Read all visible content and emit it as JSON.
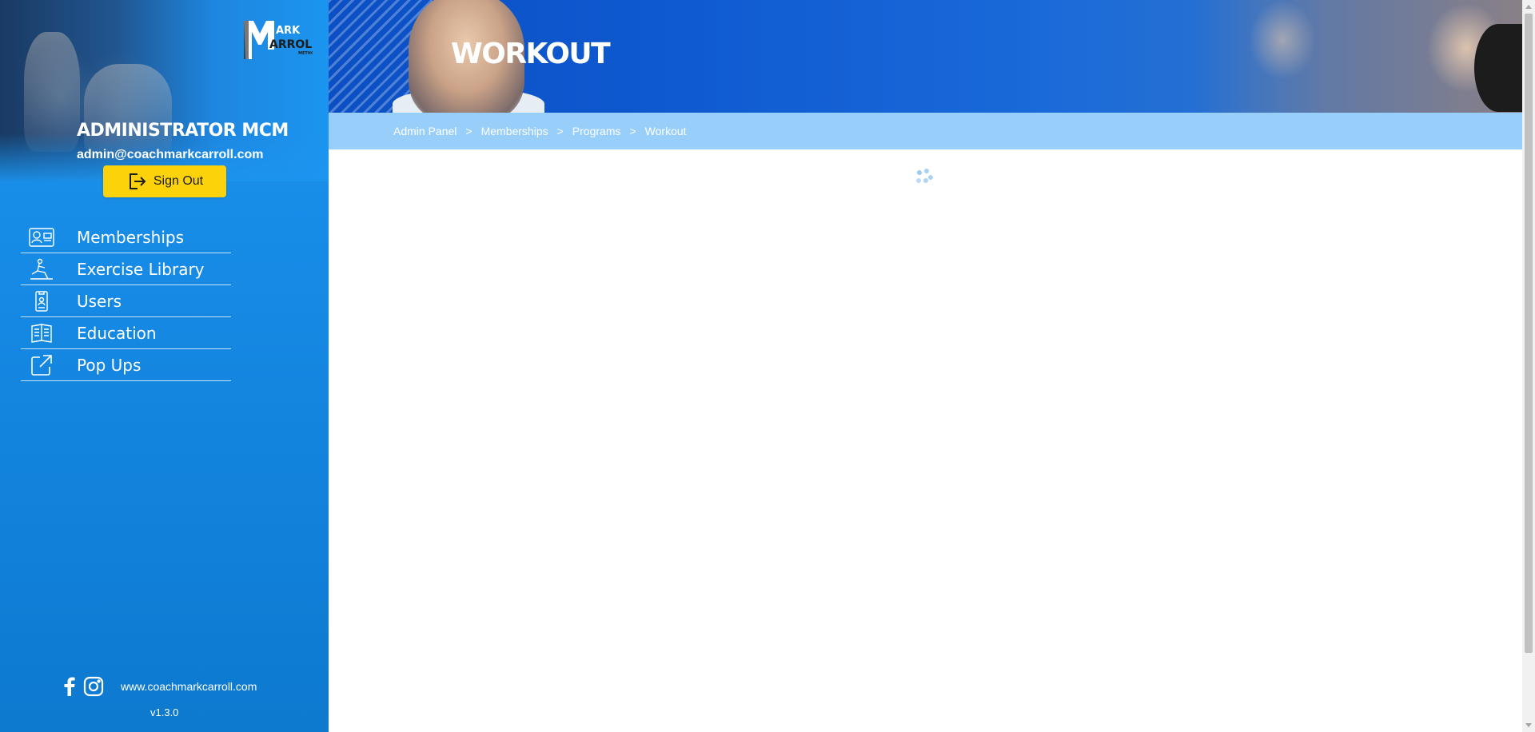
{
  "sidebar": {
    "logo_text": "MARK CARROLL METHOD",
    "profile": {
      "name": "ADMINISTRATOR MCM",
      "email": "admin@coachmarkcarroll.com"
    },
    "sign_out_label": "Sign Out",
    "nav_items": [
      {
        "label": "Memberships",
        "icon": "membership-card-icon"
      },
      {
        "label": "Exercise Library",
        "icon": "exercise-icon"
      },
      {
        "label": "Users",
        "icon": "user-badge-icon"
      },
      {
        "label": "Education",
        "icon": "book-icon"
      },
      {
        "label": "Pop Ups",
        "icon": "external-link-icon"
      }
    ],
    "footer": {
      "social_icons": [
        "facebook-icon",
        "instagram-icon"
      ],
      "website": "www.coachmarkcarroll.com",
      "version": "v1.3.0"
    }
  },
  "main": {
    "banner_title": "WORKOUT",
    "breadcrumb": [
      "Admin Panel",
      "Memberships",
      "Programs",
      "Workout"
    ],
    "breadcrumb_separator": ">",
    "loading": true
  },
  "colors": {
    "sidebar_blue": "#1b95f0",
    "breadcrumb_bar": "#98cffa",
    "signout_yellow": "#fcd20a",
    "spinner": "#9ccbf2"
  }
}
